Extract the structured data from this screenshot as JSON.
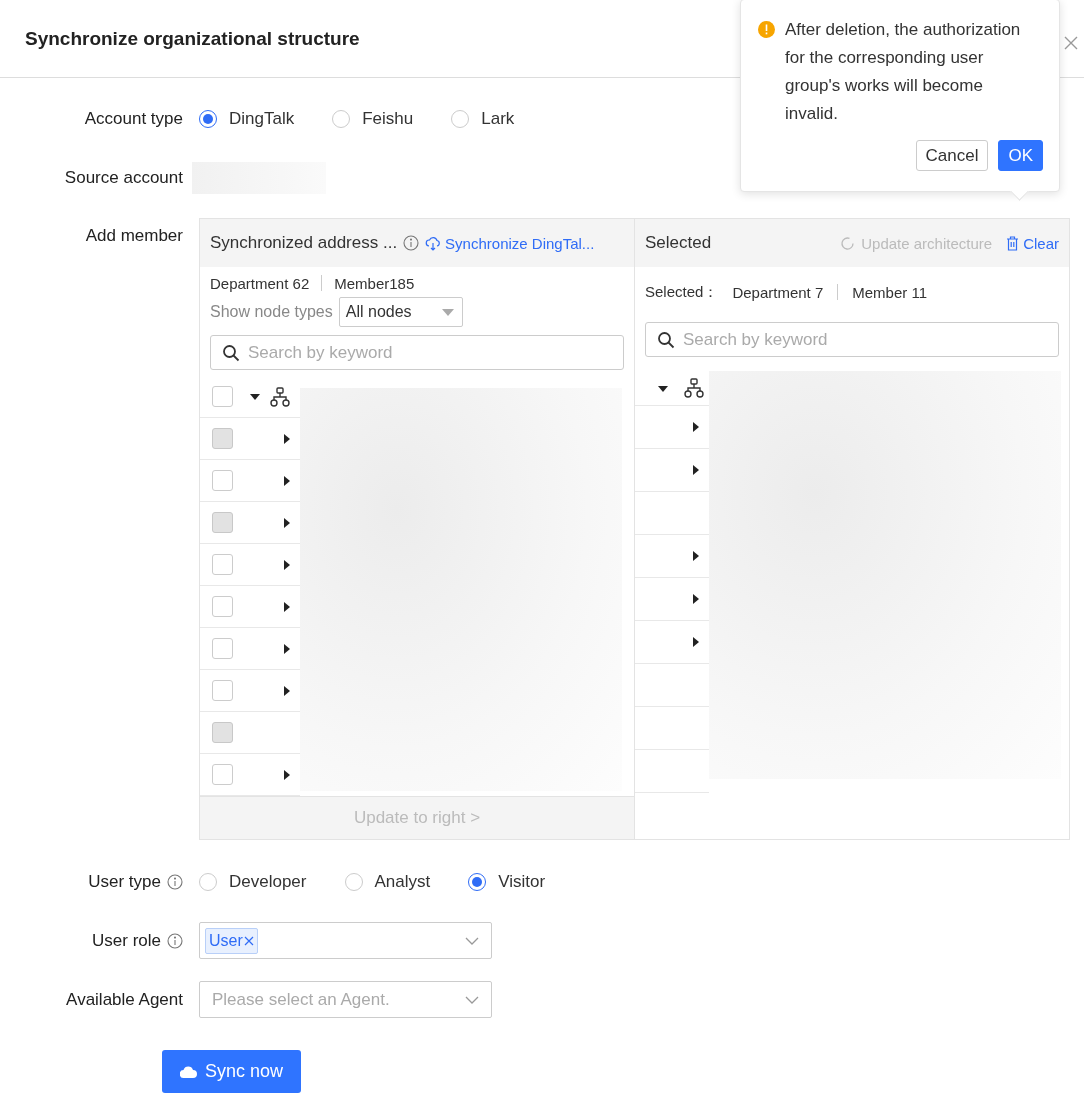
{
  "dialog": {
    "title": "Synchronize organizational structure"
  },
  "popconfirm": {
    "message": "After deletion, the authorization for the corresponding user group's works will become invalid.",
    "buttons": [
      {
        "label": "Cancel",
        "kind": "default"
      },
      {
        "label": "OK",
        "kind": "primary"
      }
    ]
  },
  "account_type": {
    "label": "Account type",
    "options": [
      {
        "label": "DingTalk",
        "selected": true
      },
      {
        "label": "Feishu",
        "selected": false
      },
      {
        "label": "Lark",
        "selected": false
      }
    ]
  },
  "source_account": {
    "label": "Source account"
  },
  "add_member": {
    "label": "Add member",
    "source": {
      "title": "Synchronized address ...",
      "sync_link": "Synchronize DingTal...",
      "department_count": "Department 62",
      "member_count": "Member185",
      "node_type_label": "Show node types",
      "node_type_value": "All nodes",
      "search_placeholder": "Search by keyword",
      "root": {
        "expanded": true,
        "checked": false
      },
      "rows": [
        {
          "disabled": true,
          "expandable": true
        },
        {
          "disabled": false,
          "expandable": true
        },
        {
          "disabled": true,
          "expandable": true
        },
        {
          "disabled": false,
          "expandable": true
        },
        {
          "disabled": false,
          "expandable": true
        },
        {
          "disabled": false,
          "expandable": true
        },
        {
          "disabled": false,
          "expandable": true
        },
        {
          "disabled": true,
          "expandable": false
        },
        {
          "disabled": false,
          "expandable": true
        }
      ],
      "footer_button": {
        "label": "Update to right >",
        "disabled": true
      }
    },
    "target": {
      "title": "Selected",
      "update_action": {
        "label": "Update architecture",
        "disabled": true
      },
      "clear_action": "Clear",
      "summary_label": "Selected：",
      "department_count": "Department 7",
      "member_count": "Member 11",
      "search_placeholder": "Search by keyword",
      "root": {
        "expanded": true
      },
      "rows": [
        {
          "expandable": true
        },
        {
          "expandable": true
        },
        {
          "expandable": false
        },
        {
          "expandable": true
        },
        {
          "expandable": true
        },
        {
          "expandable": true
        },
        {
          "expandable": false
        },
        {
          "expandable": false
        },
        {
          "expandable": false
        }
      ]
    }
  },
  "user_type": {
    "label": "User type",
    "options": [
      {
        "label": "Developer",
        "selected": false
      },
      {
        "label": "Analyst",
        "selected": false
      },
      {
        "label": "Visitor",
        "selected": true
      }
    ]
  },
  "user_role": {
    "label": "User role",
    "tags": [
      "User"
    ]
  },
  "available_agent": {
    "label": "Available Agent",
    "placeholder": "Please select an Agent."
  },
  "submit": {
    "label": "Sync now"
  }
}
